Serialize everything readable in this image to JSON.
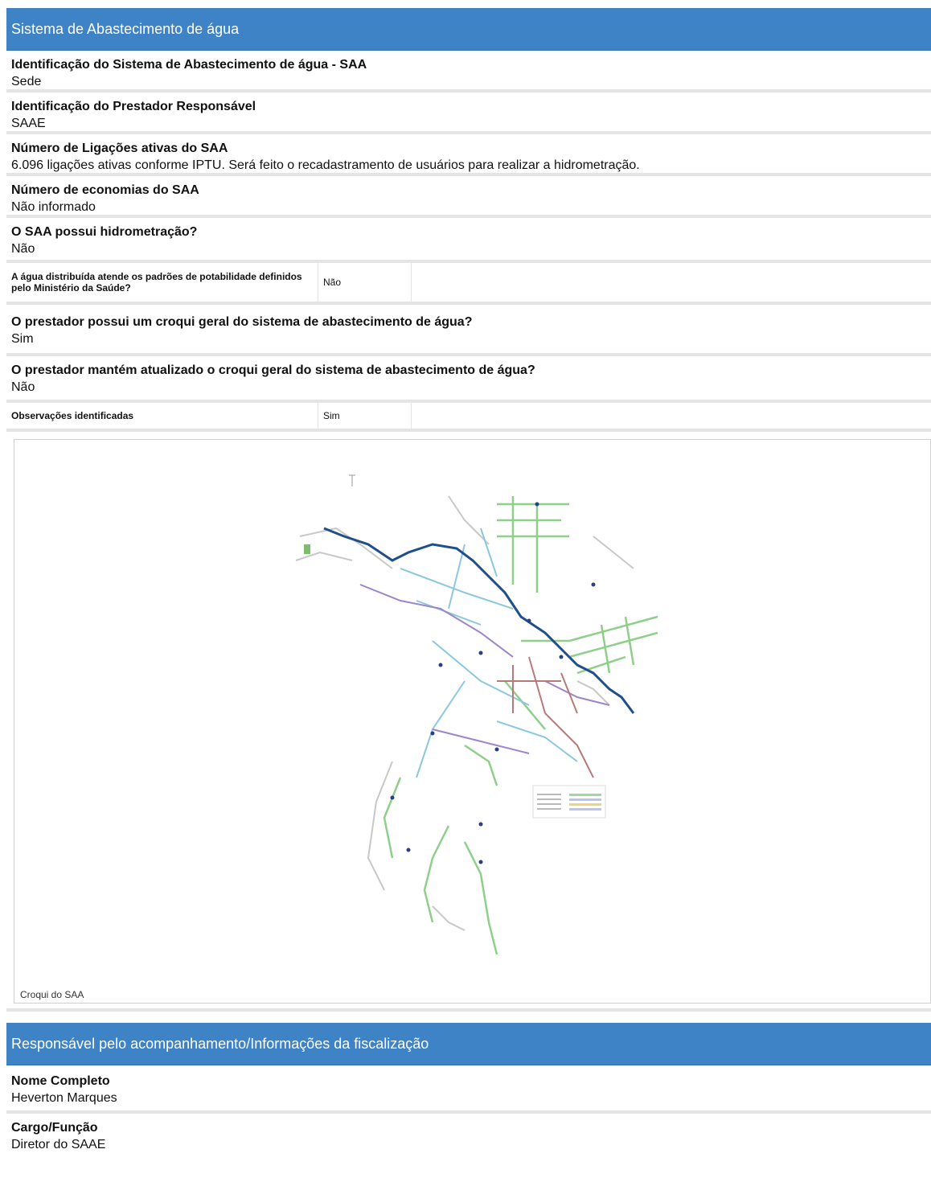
{
  "sections": [
    {
      "title": "Sistema de Abastecimento de água"
    },
    {
      "title": "Responsável pelo acompanhamento/Informações da fiscalização"
    }
  ],
  "saa": {
    "fields": [
      {
        "label": "Identificação do Sistema de Abastecimento de água - SAA",
        "value": "Sede"
      },
      {
        "label": "Identificação do Prestador Responsável",
        "value": "SAAE"
      },
      {
        "label": "Número de Ligações ativas do SAA",
        "value": "6.096 ligações ativas conforme IPTU. Será feito o recadastramento de usuários para realizar a hidrometração."
      },
      {
        "label": "Número de economias do SAA",
        "value": "Não informado"
      },
      {
        "label": "O SAA possui hidrometração?",
        "value": "Não"
      }
    ],
    "potability": {
      "label": "A água distribuída atende os padrões de potabilidade definidos pelo Ministério da Saúde?",
      "value": "Não"
    },
    "fields2": [
      {
        "label": "O prestador possui um croqui geral do sistema de abastecimento de água?",
        "value": "Sim"
      },
      {
        "label": "O prestador mantém atualizado o croqui geral do sistema de abastecimento de água?",
        "value": "Não"
      }
    ],
    "observations": {
      "label": "Observações identificadas",
      "value": "Sim"
    },
    "figure_caption": "Croqui do SAA"
  },
  "responsavel": {
    "fields": [
      {
        "label": "Nome Completo",
        "value": "Heverton Marques"
      },
      {
        "label": "Cargo/Função",
        "value": "Diretor do SAAE"
      }
    ]
  },
  "colors": {
    "header": "#3d83c5",
    "river": "#1f4e8c",
    "separator": "#e4e4e4"
  }
}
